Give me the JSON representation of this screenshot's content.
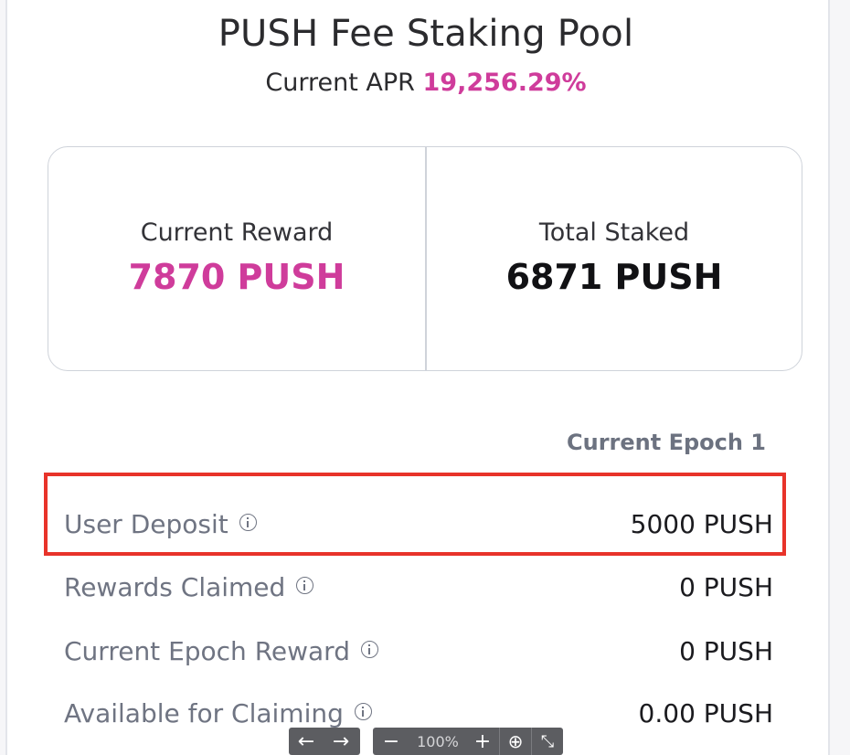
{
  "pool": {
    "title": "PUSH Fee Staking Pool",
    "apr_label": "Current APR",
    "apr_value": "19,256.29%"
  },
  "stats": {
    "current_reward_label": "Current Reward",
    "current_reward_value": "7870 PUSH",
    "total_staked_label": "Total Staked",
    "total_staked_value": "6871 PUSH"
  },
  "epoch": {
    "label": "Current Epoch 1"
  },
  "rows": [
    {
      "label": "User Deposit",
      "value": "5000 PUSH"
    },
    {
      "label": "Rewards Claimed",
      "value": "0 PUSH"
    },
    {
      "label": "Current Epoch Reward",
      "value": "0 PUSH"
    },
    {
      "label": "Available for Claiming",
      "value": "0.00 PUSH"
    }
  ],
  "viewer": {
    "prev": "←",
    "next": "→",
    "zoom_out": "−",
    "zoom_level": "100%",
    "zoom_in": "+",
    "download": "⊕",
    "collapse": "⤡"
  },
  "colors": {
    "accent_pink": "#cf3c9b",
    "highlight_red": "#e8332a"
  },
  "icons": {
    "info": "info-icon",
    "download": "download-icon",
    "collapse": "collapse-icon"
  }
}
